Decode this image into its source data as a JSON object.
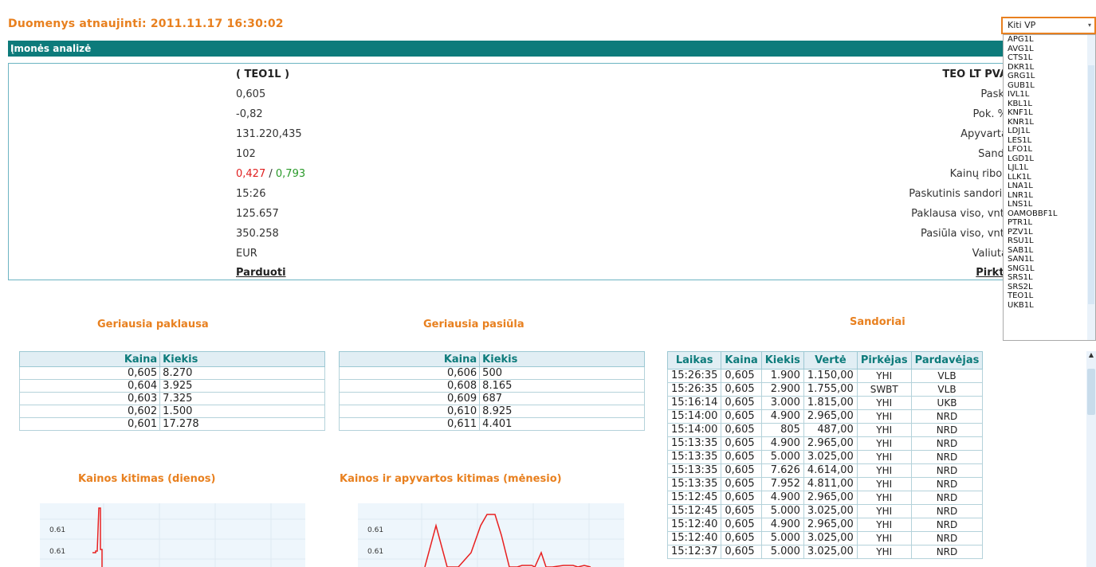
{
  "header": {
    "updated": "Duomenys atnaujinti: 2011.11.17 16:30:02"
  },
  "section": {
    "title": "Įmonės analizė"
  },
  "company": {
    "name": "TEO LT PVA",
    "code": "( TEO1L )",
    "rows": [
      {
        "label": "Pask.",
        "value": "0,605"
      },
      {
        "label": "Pok. %",
        "value": "-0,82"
      },
      {
        "label": "Apyvarta",
        "value": "131.220,435"
      },
      {
        "label": "Sand.",
        "value": "102"
      },
      {
        "label": "Kainų ribos",
        "low": "0,427",
        "sep": "/",
        "high": "0,793"
      },
      {
        "label": "Paskutinis sandoris",
        "value": "15:26"
      },
      {
        "label": "Paklausa viso, vnt.",
        "value": "125.657"
      },
      {
        "label": "Pasiūla viso, vnt.",
        "value": "350.258"
      },
      {
        "label": "Valiuta",
        "value": "EUR"
      }
    ],
    "buy": "Pirkti",
    "sell": "Parduoti"
  },
  "bids": {
    "title": "Geriausia paklausa",
    "headers": [
      "Kaina",
      "Kiekis"
    ],
    "rows": [
      [
        "0,605",
        "8.270"
      ],
      [
        "0,604",
        "3.925"
      ],
      [
        "0,603",
        "7.325"
      ],
      [
        "0,602",
        "1.500"
      ],
      [
        "0,601",
        "17.278"
      ]
    ]
  },
  "asks": {
    "title": "Geriausia pasiūla",
    "headers": [
      "Kaina",
      "Kiekis"
    ],
    "rows": [
      [
        "0,606",
        "500"
      ],
      [
        "0,608",
        "8.165"
      ],
      [
        "0,609",
        "687"
      ],
      [
        "0,610",
        "8.925"
      ],
      [
        "0,611",
        "4.401"
      ]
    ]
  },
  "trades": {
    "title": "Sandoriai",
    "headers": [
      "Laikas",
      "Kaina",
      "Kiekis",
      "Vertė",
      "Pirkėjas",
      "Pardavėjas"
    ],
    "rows": [
      [
        "15:26:35",
        "0,605",
        "1.900",
        "1.150,00",
        "YHI",
        "VLB"
      ],
      [
        "15:26:35",
        "0,605",
        "2.900",
        "1.755,00",
        "SWBT",
        "VLB"
      ],
      [
        "15:16:14",
        "0,605",
        "3.000",
        "1.815,00",
        "YHI",
        "UKB"
      ],
      [
        "15:14:00",
        "0,605",
        "4.900",
        "2.965,00",
        "YHI",
        "NRD"
      ],
      [
        "15:14:00",
        "0,605",
        "805",
        "487,00",
        "YHI",
        "NRD"
      ],
      [
        "15:13:35",
        "0,605",
        "4.900",
        "2.965,00",
        "YHI",
        "NRD"
      ],
      [
        "15:13:35",
        "0,605",
        "5.000",
        "3.025,00",
        "YHI",
        "NRD"
      ],
      [
        "15:13:35",
        "0,605",
        "7.626",
        "4.614,00",
        "YHI",
        "NRD"
      ],
      [
        "15:13:35",
        "0,605",
        "7.952",
        "4.811,00",
        "YHI",
        "NRD"
      ],
      [
        "15:12:45",
        "0,605",
        "4.900",
        "2.965,00",
        "YHI",
        "NRD"
      ],
      [
        "15:12:45",
        "0,605",
        "5.000",
        "3.025,00",
        "YHI",
        "NRD"
      ],
      [
        "15:12:40",
        "0,605",
        "4.900",
        "2.965,00",
        "YHI",
        "NRD"
      ],
      [
        "15:12:40",
        "0,605",
        "5.000",
        "3.025,00",
        "YHI",
        "NRD"
      ],
      [
        "15:12:37",
        "0,605",
        "5.000",
        "3.025,00",
        "YHI",
        "NRD"
      ]
    ]
  },
  "charts": {
    "daily_title": "Kainos kitimas (dienos)",
    "monthly_title": "Kainos ir apyvartos kitimas (mėnesio)",
    "tick_label": "0.61"
  },
  "selector": {
    "value": "Kiti VP",
    "options": [
      "APG1L",
      "AVG1L",
      "CTS1L",
      "DKR1L",
      "GRG1L",
      "GUB1L",
      "IVL1L",
      "KBL1L",
      "KNF1L",
      "KNR1L",
      "LDJ1L",
      "LES1L",
      "LFO1L",
      "LGD1L",
      "LJL1L",
      "LLK1L",
      "LNA1L",
      "LNR1L",
      "LNS1L",
      "OAMOBBF1L",
      "PTR1L",
      "PZV1L",
      "RSU1L",
      "SAB1L",
      "SAN1L",
      "SNG1L",
      "SRS1L",
      "SRS2L",
      "TEO1L",
      "UKB1L"
    ]
  },
  "colors": {
    "accent": "#e8801f",
    "teal": "#0d7b7b",
    "negative": "#e02020",
    "positive": "#2a9a2a",
    "line": "#e82020"
  }
}
